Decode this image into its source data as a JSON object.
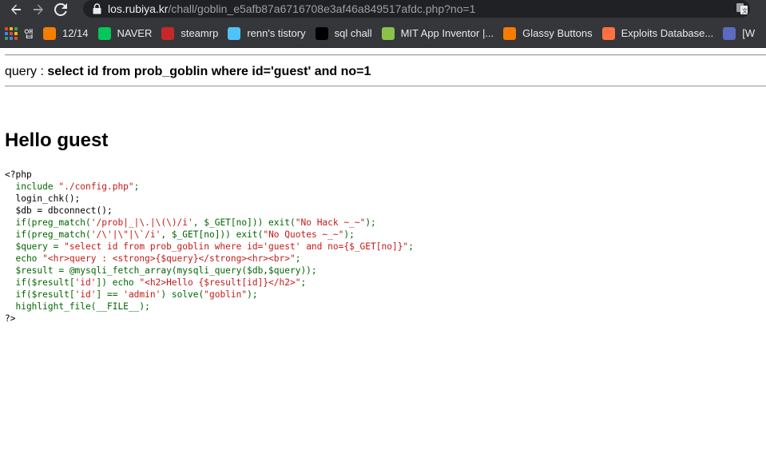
{
  "browser": {
    "url_host": "los.rubiya.kr",
    "url_path": "/chall/goblin_e5afb87a6716708e3af46a849517afdc.php?no=1",
    "back_icon": "arrow-left-icon",
    "forward_icon": "arrow-right-icon",
    "reload_icon": "reload-icon",
    "lock_icon": "lock-icon",
    "extension_icon": "translate-icon"
  },
  "bookmarks": [
    {
      "label": "앱",
      "icon": "apps-grid-icon",
      "color": "#e8eaed"
    },
    {
      "label": "12/14",
      "icon": "blogger-icon",
      "color": "#f57d00"
    },
    {
      "label": "NAVER",
      "icon": "naver-icon",
      "color": "#03c75a"
    },
    {
      "label": "steamrp",
      "icon": "steamrp-icon",
      "color": "#c62828"
    },
    {
      "label": "renn's tistory",
      "icon": "tistory-icon",
      "color": "#4fc3f7"
    },
    {
      "label": "sql chall",
      "icon": "z-icon",
      "color": "#000000"
    },
    {
      "label": "MIT App Inventor |...",
      "icon": "app-inventor-icon",
      "color": "#8bc34a"
    },
    {
      "label": "Glassy Buttons",
      "icon": "glassy-buttons-icon",
      "color": "#f57c00"
    },
    {
      "label": "Exploits Database...",
      "icon": "exploit-db-icon",
      "color": "#ff7043"
    },
    {
      "label": "[W",
      "icon": "wiki-icon",
      "color": "#5c6bc0"
    }
  ],
  "page": {
    "query_label": "query : ",
    "query_text": "select id from prob_goblin where id='guest' and no=1",
    "hello_text": "Hello guest"
  },
  "source_code": [
    [
      {
        "t": "<?php",
        "c": "html"
      }
    ],
    [
      {
        "t": "  include ",
        "c": "keyword"
      },
      {
        "t": "\"./config.php\"",
        "c": "string"
      },
      {
        "t": ";",
        "c": "keyword"
      }
    ],
    [
      {
        "t": "  login_chk();",
        "c": "default"
      }
    ],
    [
      {
        "t": "  $db = dbconnect();",
        "c": "default"
      }
    ],
    [
      {
        "t": "  if(preg_match('/prob|_|\\.|\\(\\)/i', $_GET[no])) exit(\"No Hack ~_~\");",
        "c": "mixed",
        "parts": [
          {
            "t": "  if(preg_match(",
            "c": "keyword"
          },
          {
            "t": "'/prob|_|\\.|\\(\\)/i'",
            "c": "string"
          },
          {
            "t": ", $_GET[no])) exit(",
            "c": "keyword"
          },
          {
            "t": "\"No Hack ~_~\"",
            "c": "string"
          },
          {
            "t": ");",
            "c": "keyword"
          }
        ]
      }
    ],
    [
      {
        "t": "",
        "c": "mixed",
        "parts": [
          {
            "t": "  if(preg_match(",
            "c": "keyword"
          },
          {
            "t": "'/\\'|\\\"|\\`/i'",
            "c": "string"
          },
          {
            "t": ", $_GET[no])) exit(",
            "c": "keyword"
          },
          {
            "t": "\"No Quotes ~_~\"",
            "c": "string"
          },
          {
            "t": ");",
            "c": "keyword"
          }
        ]
      }
    ],
    [
      {
        "t": "",
        "c": "mixed",
        "parts": [
          {
            "t": "  $query = ",
            "c": "keyword"
          },
          {
            "t": "\"select id from prob_goblin where id='guest' and no={$_GET[no]}\"",
            "c": "string"
          },
          {
            "t": ";",
            "c": "keyword"
          }
        ]
      }
    ],
    [
      {
        "t": "",
        "c": "mixed",
        "parts": [
          {
            "t": "  echo ",
            "c": "keyword"
          },
          {
            "t": "\"<hr>query : <strong>{$query}</strong><hr><br>\"",
            "c": "string"
          },
          {
            "t": ";",
            "c": "keyword"
          }
        ]
      }
    ],
    [
      {
        "t": "  $result = @mysqli_fetch_array(mysqli_query($db,$query));",
        "c": "keyword"
      }
    ],
    [
      {
        "t": "",
        "c": "mixed",
        "parts": [
          {
            "t": "  if($result[",
            "c": "keyword"
          },
          {
            "t": "'id'",
            "c": "string"
          },
          {
            "t": "]) echo ",
            "c": "keyword"
          },
          {
            "t": "\"<h2>Hello {$result[id]}</h2>\"",
            "c": "string"
          },
          {
            "t": ";",
            "c": "keyword"
          }
        ]
      }
    ],
    [
      {
        "t": "",
        "c": "mixed",
        "parts": [
          {
            "t": "  if($result[",
            "c": "keyword"
          },
          {
            "t": "'id'",
            "c": "string"
          },
          {
            "t": "] == ",
            "c": "keyword"
          },
          {
            "t": "'admin'",
            "c": "string"
          },
          {
            "t": ") solve(",
            "c": "keyword"
          },
          {
            "t": "\"goblin\"",
            "c": "string"
          },
          {
            "t": ");",
            "c": "keyword"
          }
        ]
      }
    ],
    [
      {
        "t": "  highlight_file(__FILE__);",
        "c": "keyword"
      }
    ],
    [
      {
        "t": "?>",
        "c": "html"
      }
    ]
  ]
}
